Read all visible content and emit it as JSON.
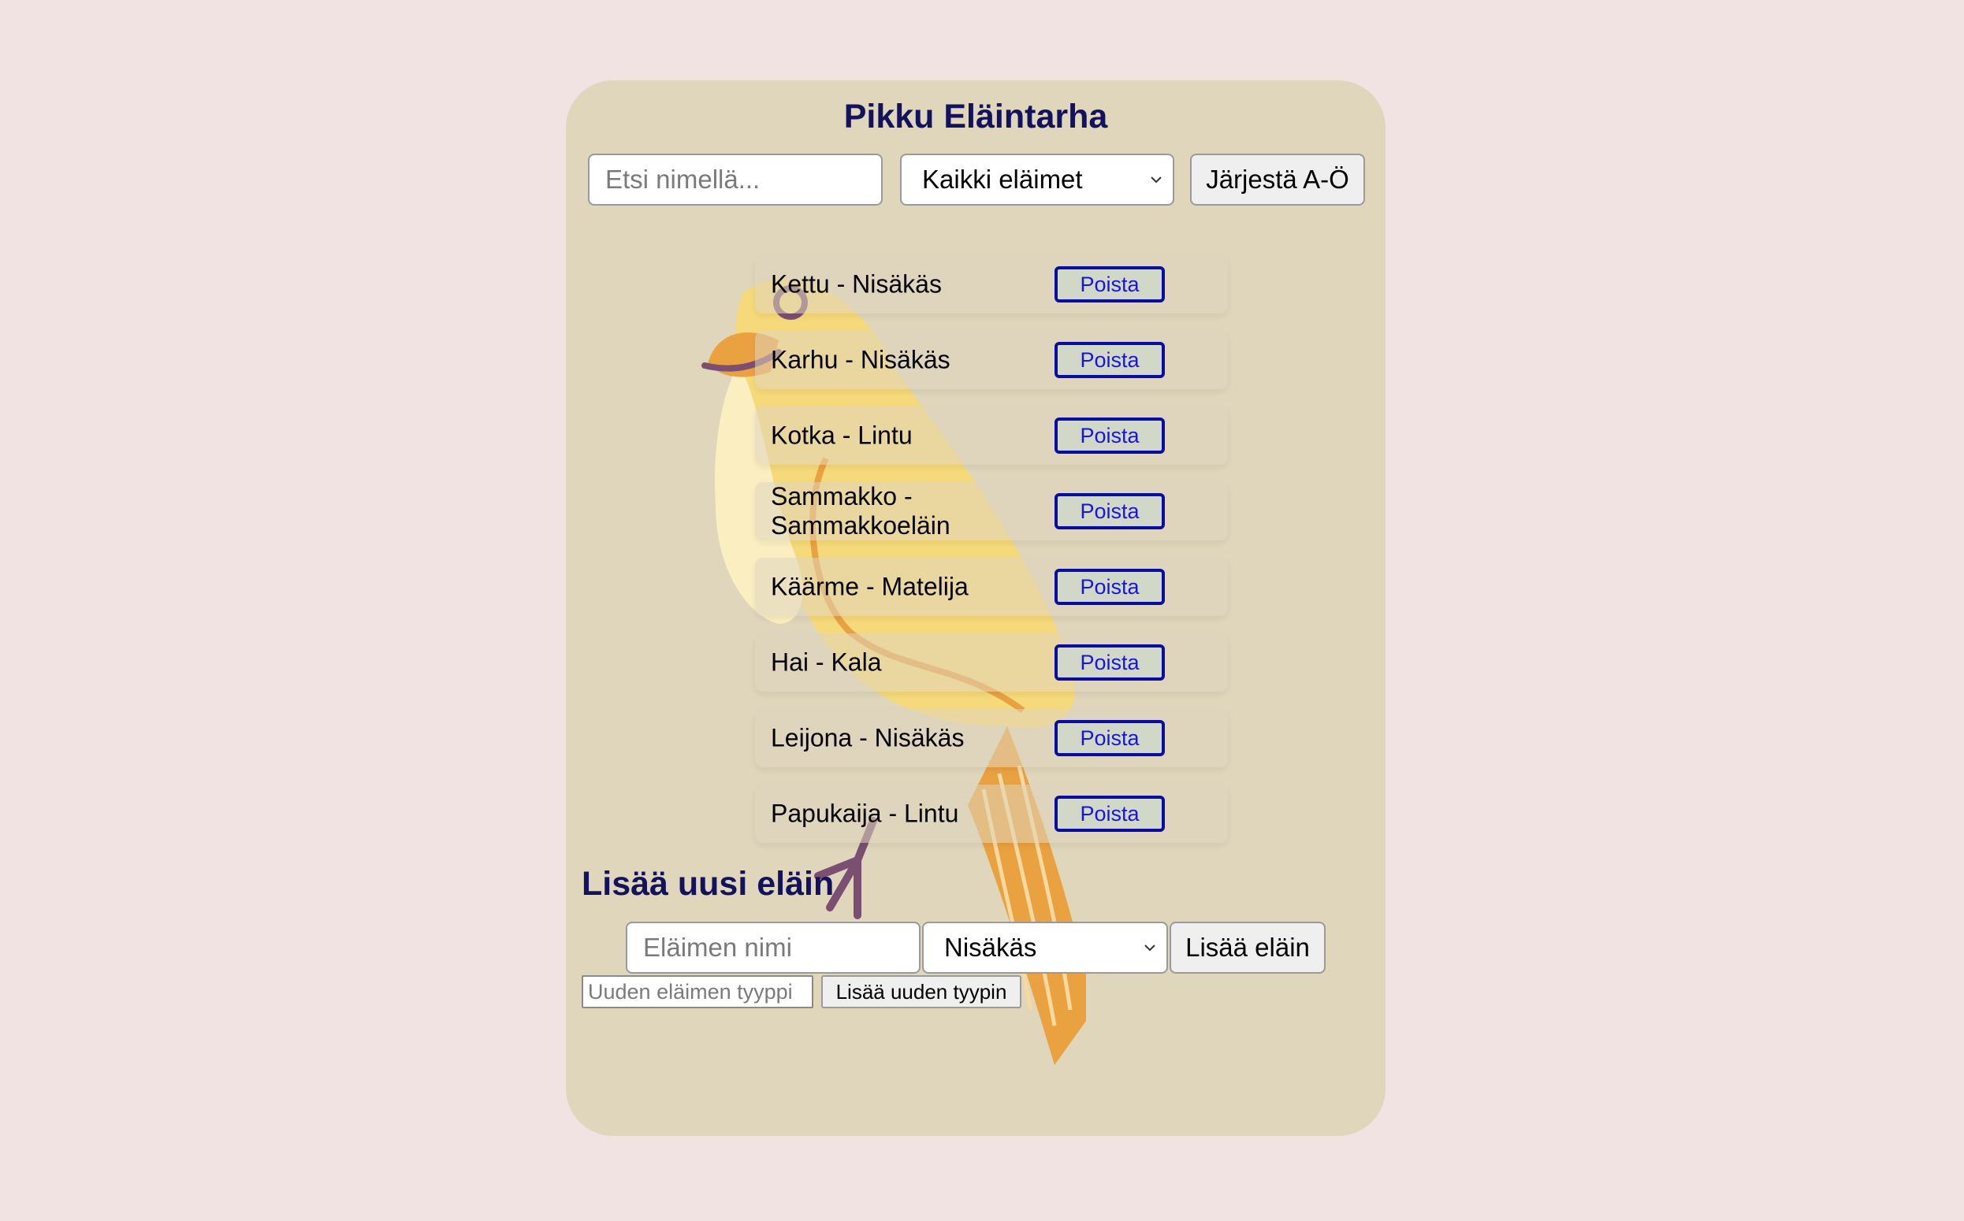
{
  "app": {
    "title": "Pikku Eläintarha"
  },
  "controls": {
    "search_placeholder": "Etsi nimellä...",
    "filter_selected": "Kaikki eläimet",
    "sort_label": "Järjestä A-Ö"
  },
  "animals": [
    {
      "label": "Kettu - Nisäkäs",
      "delete_label": "Poista"
    },
    {
      "label": "Karhu - Nisäkäs",
      "delete_label": "Poista"
    },
    {
      "label": "Kotka - Lintu",
      "delete_label": "Poista"
    },
    {
      "label": "Sammakko - Sammakkoeläin",
      "delete_label": "Poista"
    },
    {
      "label": "Käärme - Matelija",
      "delete_label": "Poista"
    },
    {
      "label": "Hai - Kala",
      "delete_label": "Poista"
    },
    {
      "label": "Leijona - Nisäkäs",
      "delete_label": "Poista"
    },
    {
      "label": "Papukaija - Lintu",
      "delete_label": "Poista"
    }
  ],
  "add_form": {
    "heading": "Lisää uusi eläin",
    "name_placeholder": "Eläimen nimi",
    "type_selected": "Nisäkäs",
    "add_label": "Lisää eläin",
    "new_type_placeholder": "Uuden eläimen tyyppi",
    "add_type_label": "Lisää uuden tyypin"
  },
  "colors": {
    "page_background": "#f0e3e2",
    "card_background": "#dfd6bc",
    "heading": "#13125e",
    "delete_border": "#0b0ca4",
    "delete_text": "#1515e2",
    "delete_background": "#d2d8c8",
    "bird_body": "#f5d97a",
    "bird_tail": "#eaa140",
    "bird_accent": "#7b4f72"
  },
  "decoration": {
    "background_illustration": "yellow-bird-illustration"
  }
}
